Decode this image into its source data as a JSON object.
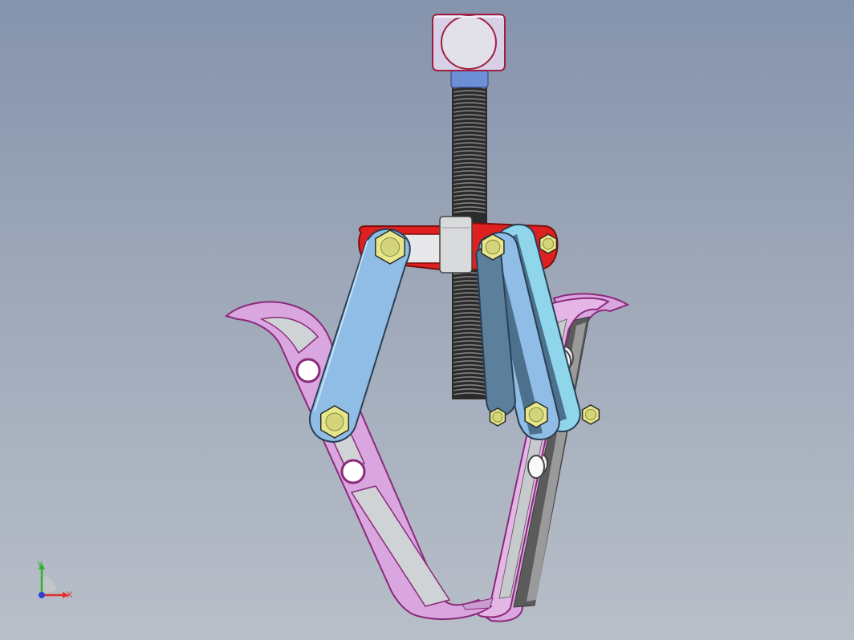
{
  "viewport": {
    "model_name": "gear-puller-assembly",
    "background_top": "#8593ad",
    "background_bottom": "#b8bfc9"
  },
  "colors": {
    "jaw": "#d9a6df",
    "jaw_edge": "#8a2a7a",
    "jaw_slot": "#d0d3d6",
    "link": "#8fbde6",
    "link_dark": "#4d708d",
    "link_edge": "#2a3f55",
    "bolt": "#e6e68a",
    "crossbar": "#e02020",
    "crossbar_face": "#d8dadc",
    "handle": "#d7d0e6",
    "handle_edge": "#a02040",
    "collar": "#6d8fd6",
    "thread": "#333333"
  },
  "triad": {
    "x_label": "X",
    "y_label": "Y",
    "x_color": "#e0302a",
    "y_color": "#30b030",
    "z_color": "#3040d0"
  }
}
